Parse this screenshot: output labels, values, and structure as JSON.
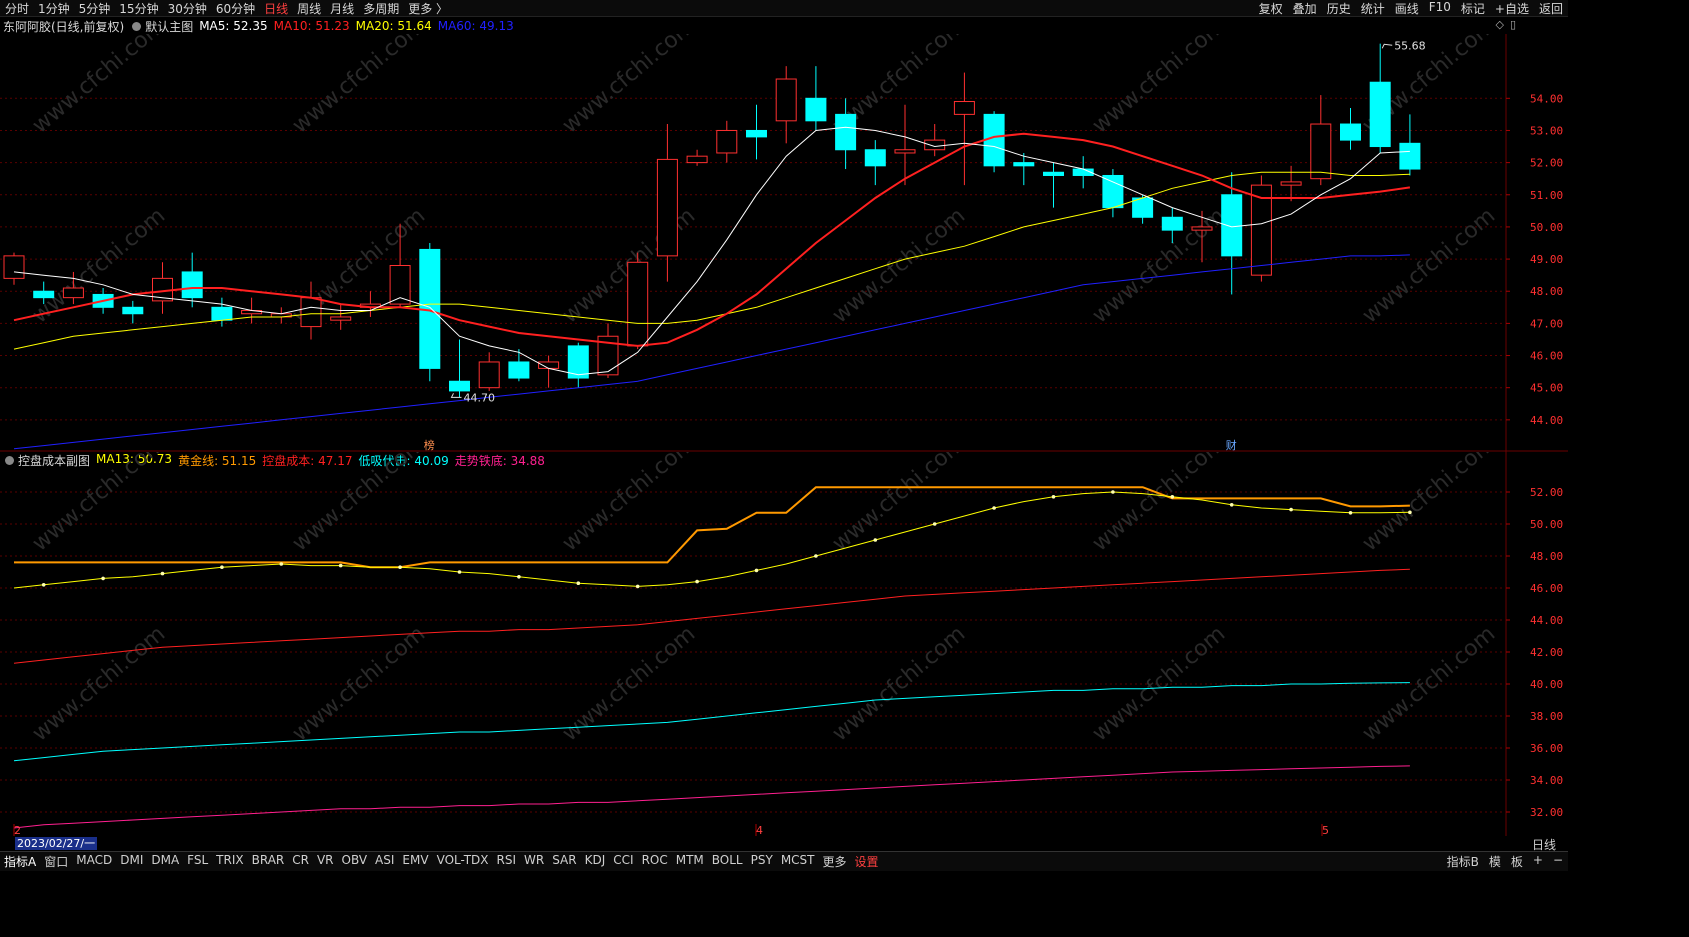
{
  "toolbar": {
    "periods": [
      "分时",
      "1分钟",
      "5分钟",
      "15分钟",
      "30分钟",
      "60分钟",
      "日线",
      "周线",
      "月线",
      "多周期",
      "更多 〉"
    ],
    "active_period": "日线",
    "right_buttons": [
      "复权",
      "叠加",
      "历史",
      "统计",
      "画线",
      "F10",
      "标记",
      "+自选",
      "返回"
    ]
  },
  "main_legend": {
    "title": "东阿阿胶(日线,前复权)",
    "template": "默认主图",
    "items": [
      {
        "label": "MA5: 52.35",
        "color": "#ffffff"
      },
      {
        "label": "MA10: 51.23",
        "color": "#ff2020"
      },
      {
        "label": "MA20: 51.64",
        "color": "#ffff00"
      },
      {
        "label": "MA60: 49.13",
        "color": "#2020ff"
      }
    ]
  },
  "sub_legend": {
    "title": "控盘成本副图",
    "items": [
      {
        "label": "MA13: 50.73",
        "color": "#ffff00"
      },
      {
        "label": "黄金线: 51.15",
        "color": "#ff9900"
      },
      {
        "label": "控盘成本: 47.17",
        "color": "#ff2020"
      },
      {
        "label": "低吸伏击: 40.09",
        "color": "#00ffff"
      },
      {
        "label": "走势铁底: 34.88",
        "color": "#ff2090"
      }
    ]
  },
  "date_box": "2023/02/27/一",
  "dayline_label": "日线",
  "chart_data": [
    {
      "type": "candlestick",
      "y_ticks": [
        "54.00",
        "53.00",
        "52.00",
        "51.00",
        "50.00",
        "49.00",
        "48.00",
        "47.00",
        "46.00",
        "45.00",
        "44.00"
      ],
      "ylim": [
        43.0,
        56.0
      ],
      "candles": [
        {
          "o": 48.4,
          "c": 49.1,
          "h": 49.2,
          "l": 48.2
        },
        {
          "o": 48.0,
          "c": 47.8,
          "h": 48.3,
          "l": 47.6
        },
        {
          "o": 47.8,
          "c": 48.1,
          "h": 48.6,
          "l": 47.6
        },
        {
          "o": 47.9,
          "c": 47.5,
          "h": 48.1,
          "l": 47.3
        },
        {
          "o": 47.5,
          "c": 47.3,
          "h": 47.7,
          "l": 47.0
        },
        {
          "o": 47.7,
          "c": 48.4,
          "h": 48.9,
          "l": 47.3
        },
        {
          "o": 48.6,
          "c": 47.8,
          "h": 49.2,
          "l": 47.5
        },
        {
          "o": 47.5,
          "c": 47.1,
          "h": 47.8,
          "l": 46.9
        },
        {
          "o": 47.3,
          "c": 47.4,
          "h": 47.8,
          "l": 47.0
        },
        {
          "o": 47.2,
          "c": 47.3,
          "h": 47.5,
          "l": 47.0
        },
        {
          "o": 46.9,
          "c": 47.8,
          "h": 48.3,
          "l": 46.5
        },
        {
          "o": 47.1,
          "c": 47.2,
          "h": 47.6,
          "l": 46.8
        },
        {
          "o": 47.5,
          "c": 47.6,
          "h": 48.0,
          "l": 47.2
        },
        {
          "o": 47.6,
          "c": 48.8,
          "h": 50.1,
          "l": 47.5
        },
        {
          "o": 49.3,
          "c": 45.6,
          "h": 49.5,
          "l": 45.2
        },
        {
          "o": 45.2,
          "c": 44.9,
          "h": 46.5,
          "l": 44.7
        },
        {
          "o": 45.0,
          "c": 45.8,
          "h": 46.1,
          "l": 44.9
        },
        {
          "o": 45.8,
          "c": 45.3,
          "h": 46.2,
          "l": 45.2
        },
        {
          "o": 45.6,
          "c": 45.8,
          "h": 46.0,
          "l": 45.0
        },
        {
          "o": 46.3,
          "c": 45.3,
          "h": 46.4,
          "l": 45.0
        },
        {
          "o": 45.4,
          "c": 46.6,
          "h": 47.0,
          "l": 45.3
        },
        {
          "o": 46.3,
          "c": 48.9,
          "h": 49.2,
          "l": 46.2
        },
        {
          "o": 49.1,
          "c": 52.1,
          "h": 53.2,
          "l": 48.3
        },
        {
          "o": 52.0,
          "c": 52.2,
          "h": 52.4,
          "l": 51.9
        },
        {
          "o": 52.3,
          "c": 53.0,
          "h": 53.3,
          "l": 52.0
        },
        {
          "o": 53.0,
          "c": 52.8,
          "h": 53.8,
          "l": 52.1
        },
        {
          "o": 53.3,
          "c": 54.6,
          "h": 55.0,
          "l": 52.6
        },
        {
          "o": 54.0,
          "c": 53.3,
          "h": 55.0,
          "l": 53.0
        },
        {
          "o": 53.5,
          "c": 52.4,
          "h": 54.0,
          "l": 51.8
        },
        {
          "o": 52.4,
          "c": 51.9,
          "h": 52.7,
          "l": 51.3
        },
        {
          "o": 52.3,
          "c": 52.4,
          "h": 53.8,
          "l": 51.3
        },
        {
          "o": 52.4,
          "c": 52.7,
          "h": 53.2,
          "l": 52.2
        },
        {
          "o": 53.5,
          "c": 53.9,
          "h": 54.8,
          "l": 51.3
        },
        {
          "o": 53.5,
          "c": 51.9,
          "h": 53.6,
          "l": 51.7
        },
        {
          "o": 52.0,
          "c": 51.9,
          "h": 52.3,
          "l": 51.3
        },
        {
          "o": 51.7,
          "c": 51.6,
          "h": 52.0,
          "l": 50.6
        },
        {
          "o": 51.8,
          "c": 51.6,
          "h": 52.2,
          "l": 51.2
        },
        {
          "o": 51.6,
          "c": 50.6,
          "h": 51.8,
          "l": 50.3
        },
        {
          "o": 50.9,
          "c": 50.3,
          "h": 51.0,
          "l": 50.1
        },
        {
          "o": 50.3,
          "c": 49.9,
          "h": 50.6,
          "l": 49.5
        },
        {
          "o": 49.9,
          "c": 50.0,
          "h": 50.5,
          "l": 48.9
        },
        {
          "o": 51.0,
          "c": 49.1,
          "h": 51.7,
          "l": 47.9
        },
        {
          "o": 48.5,
          "c": 51.3,
          "h": 51.6,
          "l": 48.3
        },
        {
          "o": 51.3,
          "c": 51.4,
          "h": 51.9,
          "l": 50.8
        },
        {
          "o": 51.5,
          "c": 53.2,
          "h": 54.1,
          "l": 51.3
        },
        {
          "o": 53.2,
          "c": 52.7,
          "h": 53.7,
          "l": 52.4
        },
        {
          "o": 54.5,
          "c": 52.5,
          "h": 55.7,
          "l": 52.3
        },
        {
          "o": 52.6,
          "c": 51.8,
          "h": 53.5,
          "l": 51.6
        }
      ],
      "series": [
        {
          "name": "MA5",
          "color": "#ffffff",
          "values": [
            48.6,
            48.5,
            48.4,
            48.2,
            47.9,
            47.8,
            47.7,
            47.6,
            47.4,
            47.3,
            47.5,
            47.4,
            47.4,
            47.8,
            47.5,
            46.6,
            46.3,
            46.1,
            45.6,
            45.4,
            45.5,
            46.1,
            47.2,
            48.3,
            49.6,
            51.0,
            52.2,
            53.0,
            53.1,
            53.0,
            52.8,
            52.5,
            52.6,
            52.5,
            52.2,
            52.0,
            51.8,
            51.4,
            51.0,
            50.6,
            50.3,
            50.0,
            50.1,
            50.4,
            51.0,
            51.5,
            52.3,
            52.35
          ]
        },
        {
          "name": "MA10",
          "color": "#ff2020",
          "values": [
            47.1,
            47.3,
            47.5,
            47.7,
            47.9,
            48.0,
            48.1,
            48.1,
            48.0,
            47.9,
            47.8,
            47.6,
            47.5,
            47.5,
            47.4,
            47.1,
            46.9,
            46.7,
            46.6,
            46.5,
            46.4,
            46.3,
            46.4,
            46.8,
            47.3,
            47.9,
            48.7,
            49.5,
            50.2,
            50.9,
            51.5,
            52.0,
            52.5,
            52.8,
            52.9,
            52.8,
            52.7,
            52.5,
            52.2,
            51.9,
            51.6,
            51.2,
            50.9,
            50.9,
            50.9,
            51.0,
            51.1,
            51.23
          ]
        },
        {
          "name": "MA20",
          "color": "#ffff00",
          "values": [
            46.2,
            46.4,
            46.6,
            46.7,
            46.8,
            46.9,
            47.0,
            47.1,
            47.2,
            47.2,
            47.3,
            47.3,
            47.4,
            47.5,
            47.6,
            47.6,
            47.5,
            47.4,
            47.3,
            47.2,
            47.1,
            47.0,
            47.0,
            47.1,
            47.3,
            47.5,
            47.8,
            48.1,
            48.4,
            48.7,
            49.0,
            49.2,
            49.4,
            49.7,
            50.0,
            50.2,
            50.4,
            50.6,
            50.9,
            51.2,
            51.4,
            51.6,
            51.7,
            51.7,
            51.7,
            51.6,
            51.6,
            51.64
          ]
        },
        {
          "name": "MA60",
          "color": "#2020ff",
          "values": [
            43.1,
            43.2,
            43.3,
            43.4,
            43.5,
            43.6,
            43.7,
            43.8,
            43.9,
            44.0,
            44.1,
            44.2,
            44.3,
            44.4,
            44.5,
            44.6,
            44.7,
            44.8,
            44.9,
            45.0,
            45.1,
            45.2,
            45.4,
            45.6,
            45.8,
            46.0,
            46.2,
            46.4,
            46.6,
            46.8,
            47.0,
            47.2,
            47.4,
            47.6,
            47.8,
            48.0,
            48.2,
            48.3,
            48.4,
            48.5,
            48.6,
            48.7,
            48.8,
            48.9,
            49.0,
            49.1,
            49.1,
            49.13
          ]
        }
      ],
      "annotations": [
        {
          "text": "55.68",
          "value": 55.68,
          "index": 46
        },
        {
          "text": "44.70",
          "value": 44.7,
          "index": 15
        },
        {
          "text": "榜",
          "index": 14
        },
        {
          "text": "财",
          "index": 41
        }
      ]
    },
    {
      "type": "line",
      "y_ticks": [
        "52.00",
        "50.00",
        "48.00",
        "46.00",
        "44.00",
        "42.00",
        "40.00",
        "38.00",
        "36.00",
        "34.00",
        "32.00"
      ],
      "ylim": [
        30.5,
        53.5
      ],
      "series": [
        {
          "name": "黄金线",
          "color": "#ff9900",
          "values": [
            47.6,
            47.6,
            47.6,
            47.6,
            47.6,
            47.6,
            47.6,
            47.6,
            47.6,
            47.6,
            47.6,
            47.6,
            47.3,
            47.3,
            47.6,
            47.6,
            47.6,
            47.6,
            47.6,
            47.6,
            47.6,
            47.6,
            47.6,
            49.6,
            49.7,
            50.7,
            50.7,
            52.3,
            52.3,
            52.3,
            52.3,
            52.3,
            52.3,
            52.3,
            52.3,
            52.3,
            52.3,
            52.3,
            52.3,
            51.6,
            51.6,
            51.6,
            51.6,
            51.6,
            51.6,
            51.1,
            51.1,
            51.15
          ]
        },
        {
          "name": "MA13",
          "color": "#ffff00",
          "values": [
            46.0,
            46.2,
            46.4,
            46.6,
            46.7,
            46.9,
            47.1,
            47.3,
            47.4,
            47.5,
            47.4,
            47.4,
            47.3,
            47.3,
            47.2,
            47.0,
            46.9,
            46.7,
            46.5,
            46.3,
            46.2,
            46.1,
            46.2,
            46.4,
            46.7,
            47.1,
            47.5,
            48.0,
            48.5,
            49.0,
            49.5,
            50.0,
            50.5,
            51.0,
            51.4,
            51.7,
            51.9,
            52.0,
            51.9,
            51.7,
            51.5,
            51.2,
            51.0,
            50.9,
            50.8,
            50.7,
            50.7,
            50.73
          ]
        },
        {
          "name": "控盘成本",
          "color": "#ff2020",
          "values": [
            41.3,
            41.5,
            41.7,
            41.9,
            42.1,
            42.3,
            42.4,
            42.5,
            42.6,
            42.7,
            42.8,
            42.9,
            43.0,
            43.1,
            43.2,
            43.3,
            43.3,
            43.4,
            43.4,
            43.5,
            43.6,
            43.7,
            43.9,
            44.1,
            44.3,
            44.5,
            44.7,
            44.9,
            45.1,
            45.3,
            45.5,
            45.6,
            45.7,
            45.8,
            45.9,
            46.0,
            46.1,
            46.2,
            46.3,
            46.4,
            46.5,
            46.6,
            46.7,
            46.8,
            46.9,
            47.0,
            47.1,
            47.17
          ]
        },
        {
          "name": "低吸伏击",
          "color": "#00ffff",
          "values": [
            35.2,
            35.4,
            35.6,
            35.8,
            35.9,
            36.0,
            36.1,
            36.2,
            36.3,
            36.4,
            36.5,
            36.6,
            36.7,
            36.8,
            36.9,
            37.0,
            37.0,
            37.1,
            37.2,
            37.3,
            37.4,
            37.5,
            37.6,
            37.8,
            38.0,
            38.2,
            38.4,
            38.6,
            38.8,
            39.0,
            39.1,
            39.2,
            39.3,
            39.4,
            39.5,
            39.6,
            39.6,
            39.7,
            39.7,
            39.8,
            39.8,
            39.9,
            39.9,
            40.0,
            40.0,
            40.05,
            40.07,
            40.09
          ]
        },
        {
          "name": "走势铁底",
          "color": "#ff2090",
          "values": [
            31.0,
            31.2,
            31.3,
            31.4,
            31.5,
            31.6,
            31.7,
            31.8,
            31.9,
            32.0,
            32.1,
            32.2,
            32.2,
            32.3,
            32.3,
            32.4,
            32.4,
            32.5,
            32.5,
            32.6,
            32.6,
            32.7,
            32.8,
            32.9,
            33.0,
            33.1,
            33.2,
            33.3,
            33.4,
            33.5,
            33.6,
            33.7,
            33.8,
            33.9,
            34.0,
            34.1,
            34.2,
            34.3,
            34.4,
            34.5,
            34.55,
            34.6,
            34.65,
            34.7,
            34.75,
            34.8,
            34.85,
            34.88
          ]
        }
      ]
    }
  ],
  "x_markers": [
    "2",
    "4",
    "5"
  ],
  "bottom_tabs": [
    "指标A",
    "窗口",
    "MACD",
    "DMI",
    "DMA",
    "FSL",
    "TRIX",
    "BRAR",
    "CR",
    "VR",
    "OBV",
    "ASI",
    "EMV",
    "VOL-TDX",
    "RSI",
    "WR",
    "SAR",
    "KDJ",
    "CCI",
    "ROC",
    "MTM",
    "BOLL",
    "PSY",
    "MCST",
    "更多",
    "设置"
  ],
  "bottom_right": [
    "指标B",
    "模",
    "板",
    "+",
    "−"
  ],
  "watermark": "www.cfchi.com",
  "colors": {
    "up": "#ff3030",
    "down": "#00ffff",
    "grid": "#5a0000",
    "axis_text": "#ff3030"
  }
}
